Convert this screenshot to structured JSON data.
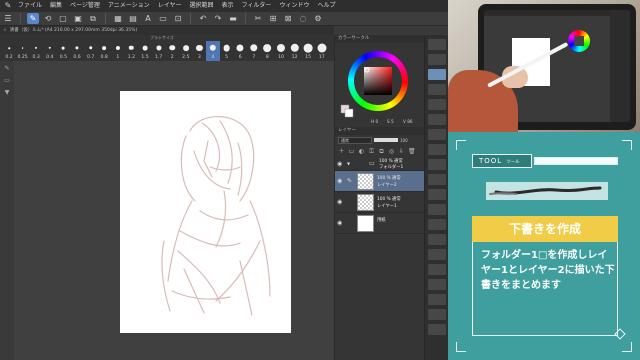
{
  "app": {
    "menu": [
      "ファイル",
      "編集",
      "ページ管理",
      "アニメーション",
      "レイヤー",
      "選択範囲",
      "表示",
      "フィルター",
      "ウィンドウ",
      "ヘルプ"
    ],
    "toolbar_icons": [
      "menu-icon",
      "pen-tool-icon",
      "transform-icon",
      "selection-icon",
      "fill-icon",
      "text-icon",
      "balloon-icon",
      "ruler-icon",
      "undo-icon",
      "redo-icon",
      "clear-icon",
      "save-icon",
      "cut-icon",
      "copy-icon",
      "paste-icon",
      "layer-icon"
    ],
    "document_tab": "清書（仮）ルム* (A4 210.00 x 297.00mm 350dpi 36.35%)",
    "brush_size_title": "ブラシサイズ",
    "brush_sizes": [
      "0.2",
      "0.25",
      "0.3",
      "0.4",
      "0.5",
      "0.6",
      "0.7",
      "0.8",
      "1",
      "1.2",
      "1.5",
      "1.7",
      "2",
      "2.5",
      "3",
      "4",
      "5",
      "6",
      "7",
      "8",
      "10",
      "12",
      "15",
      "17"
    ],
    "brush_size_selected_index": 15,
    "color_panel": {
      "title": "カラーサークル",
      "h": "H 0",
      "s": "S 5",
      "v": "V 86"
    },
    "layer_panel": {
      "title": "レイヤー",
      "blend_mode": "通常",
      "opacity": "100",
      "layers": [
        {
          "line1": "100 % 通常",
          "line2": "フォルダー1",
          "type": "folder"
        },
        {
          "line1": "100 % 通常",
          "line2": "レイヤー2",
          "type": "raster",
          "selected": true
        },
        {
          "line1": "100 % 通常",
          "line2": "レイヤー1",
          "type": "raster"
        },
        {
          "line1": "用紙",
          "line2": "",
          "type": "paper"
        }
      ]
    }
  },
  "card": {
    "tool_label": "TOOL",
    "tool_sub": "ツール",
    "title": "下書きを作成",
    "body": "フォルダー1□を作成しレイヤー1とレイヤー2に描いた下書きをまとめます",
    "accent": "#f1cc46",
    "background": "#3f9f9e"
  }
}
